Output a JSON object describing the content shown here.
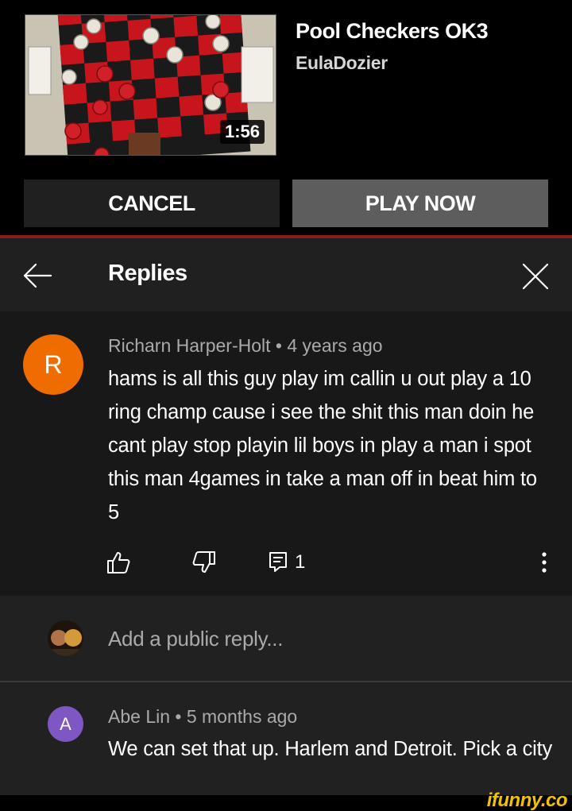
{
  "video": {
    "title": "Pool Checkers OK3",
    "channel": "EulaDozier",
    "duration": "1:56"
  },
  "buttons": {
    "cancel": "CANCEL",
    "play_now": "PLAY NOW"
  },
  "header": {
    "title": "Replies",
    "back_icon": "arrow-left-icon",
    "close_icon": "close-icon"
  },
  "comment": {
    "avatar_letter": "R",
    "author": "Richarn Harper-Holt",
    "time": "4 years ago",
    "meta": "Richarn Harper-Holt • 4 years ago",
    "text": "hams is all this guy play im callin u out play a 10 ring champ cause i see the shit this man doin he cant play stop playin lil boys in play a man i spot this man 4games in take a man off in beat him to 5",
    "reply_count": "1",
    "avatar_color": "#ef6c00"
  },
  "add_reply": {
    "placeholder": "Add a public reply..."
  },
  "reply": {
    "avatar_letter": "A",
    "author": "Abe Lin",
    "time": "5 months ago",
    "meta": "Abe Lin • 5 months ago",
    "text": "We can set that up. Harlem and Detroit. Pick a city",
    "avatar_color": "#7e57c2"
  },
  "watermark": "ifunny.co"
}
